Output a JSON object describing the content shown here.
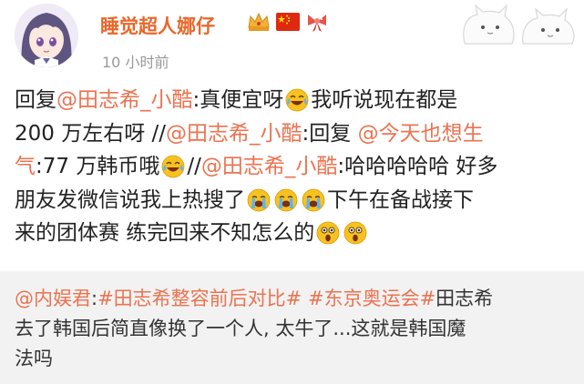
{
  "header": {
    "username": "睡觉超人娜仔",
    "timestamp": "10 小时前",
    "avatar_icon": "anime-girl-avatar",
    "badges": [
      "crown-badge-icon",
      "china-flag-icon",
      "ribbon-badge-icon"
    ],
    "decoration_icon": "cartoon-cats-icon"
  },
  "post": {
    "lines": [
      [
        {
          "t": "回复"
        },
        {
          "t": "@田志希_小酷",
          "link": true
        },
        {
          "t": ":真便宜呀"
        },
        {
          "emoji": "laugh-cry-emoji-icon"
        },
        {
          "t": "我听说现在都是"
        }
      ],
      [
        {
          "t": "200 万左右呀 //"
        },
        {
          "t": "@田志希_小酷",
          "link": true
        },
        {
          "t": ":回复 "
        },
        {
          "t": "@今天也想生",
          "link": true
        }
      ],
      [
        {
          "t": "气",
          "link": true
        },
        {
          "t": ":77 万韩币哦"
        },
        {
          "emoji": "laugh-cry-emoji-icon"
        },
        {
          "t": "//"
        },
        {
          "t": "@田志希_小酷",
          "link": true
        },
        {
          "t": ":哈哈哈哈哈 好多"
        }
      ],
      [
        {
          "t": "朋友发微信说我上热搜了"
        },
        {
          "emoji": "crying-emoji-icon"
        },
        {
          "emoji": "crying-emoji-icon"
        },
        {
          "emoji": "crying-emoji-icon"
        },
        {
          "t": "下午在备战接下"
        }
      ],
      [
        {
          "t": "来的团体赛 练完回来不知怎么的"
        },
        {
          "emoji": "shocked-emoji-icon"
        },
        {
          "emoji": "shocked-emoji-icon"
        }
      ]
    ]
  },
  "repost": {
    "lines": [
      [
        {
          "t": "@内娱君",
          "link": true
        },
        {
          "t": ":"
        },
        {
          "t": "#田志希整容前后对比#",
          "link": true
        },
        {
          "t": " "
        },
        {
          "t": "#东京奥运会#",
          "link": true
        },
        {
          "t": "田志希"
        }
      ],
      [
        {
          "t": "去了韩国后简直像换了一个人, 太牛了...这就是韩国魔"
        }
      ],
      [
        {
          "t": "法吗"
        }
      ]
    ]
  },
  "colors": {
    "username": "#e8672a",
    "link": "#eb7350",
    "timestamp": "#999999",
    "repost_bg": "#f2f2f2"
  }
}
